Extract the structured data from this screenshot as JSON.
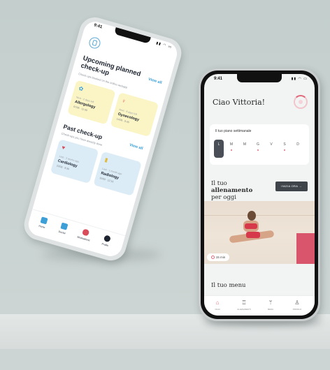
{
  "left_app": {
    "status_time": "9:41",
    "upcoming": {
      "title": "Upcoming planned check-up",
      "view_all": "View all",
      "subtitle": "Check-ups booked on the online webapp",
      "cards": [
        {
          "meta": "Next · 2 days left",
          "name": "Allergology",
          "date": "07/05 · 11:30",
          "color": "#fbf5c5"
        },
        {
          "meta": "Next · 9 days left",
          "name": "Gynecology",
          "date": "14/05 · 9:45",
          "color": "#fbf5c5"
        }
      ]
    },
    "past": {
      "title": "Past check-up",
      "view_all": "View all",
      "subtitle": "Check-ups you have already done",
      "cards": [
        {
          "meta": "Last · 2 weeks ago",
          "name": "Cardiology",
          "date": "22/03 · 9:30",
          "color": "#dcecf6"
        },
        {
          "meta": "Last · 1 month ago",
          "name": "Radiology",
          "date": "10/03 · 12:15",
          "color": "#dcecf6"
        }
      ]
    },
    "nav": [
      {
        "label": "Home",
        "icon": "home-icon",
        "color": "#3c9fd8"
      },
      {
        "label": "Doctor",
        "icon": "doctor-icon",
        "color": "#3c9fd8"
      },
      {
        "label": "Medications",
        "icon": "pill-icon",
        "color": "#d94c5a"
      },
      {
        "label": "Profile",
        "icon": "profile-icon",
        "color": "#1d2430"
      }
    ]
  },
  "right_app": {
    "status_time": "9:41",
    "greeting": "Ciao Vittoria!",
    "week": {
      "label": "Il tuo piano settimanale",
      "days": [
        "L",
        "M",
        "M",
        "G",
        "V",
        "S",
        "D"
      ]
    },
    "workout_title_prefix": "Il tuo",
    "workout_title_bold": "allenamento",
    "workout_title_suffix": "per oggi",
    "start_button": "INIZIA ORA →",
    "duration": "15 min",
    "menu_title": "Il tuo menu",
    "nav": [
      {
        "label": "OGGI",
        "icon": "house-icon"
      },
      {
        "label": "ALLENAMENTI",
        "icon": "trophy-icon"
      },
      {
        "label": "MENU",
        "icon": "fork-knife-icon"
      },
      {
        "label": "PROFILO",
        "icon": "user-icon"
      }
    ],
    "accent": "#e06a7b"
  }
}
